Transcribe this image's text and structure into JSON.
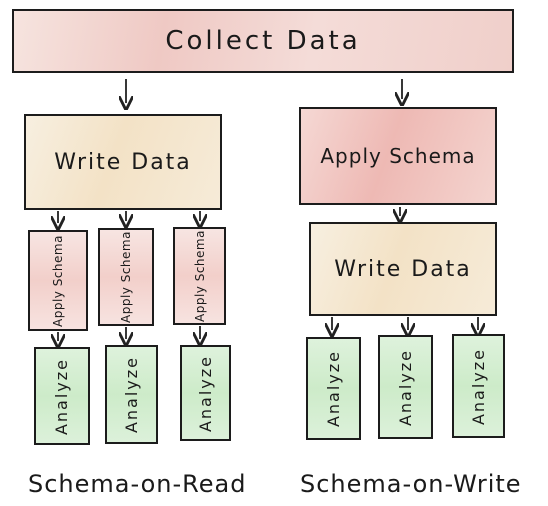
{
  "top": {
    "label": "Collect Data"
  },
  "left": {
    "write_label": "Write Data",
    "apply_label": "Apply Schema",
    "analyze_label": "Analyze",
    "caption": "Schema-on-Read"
  },
  "right": {
    "apply_label": "Apply Schema",
    "write_label": "Write Data",
    "analyze_label": "Analyze",
    "caption": "Schema-on-Write"
  },
  "colors": {
    "collect_fill": "#efc9c4",
    "write_fill": "#f3e2c6",
    "apply_fill": "#eeb9b4",
    "analyze_fill": "#cdebc9",
    "stroke": "#1c1c1c"
  }
}
